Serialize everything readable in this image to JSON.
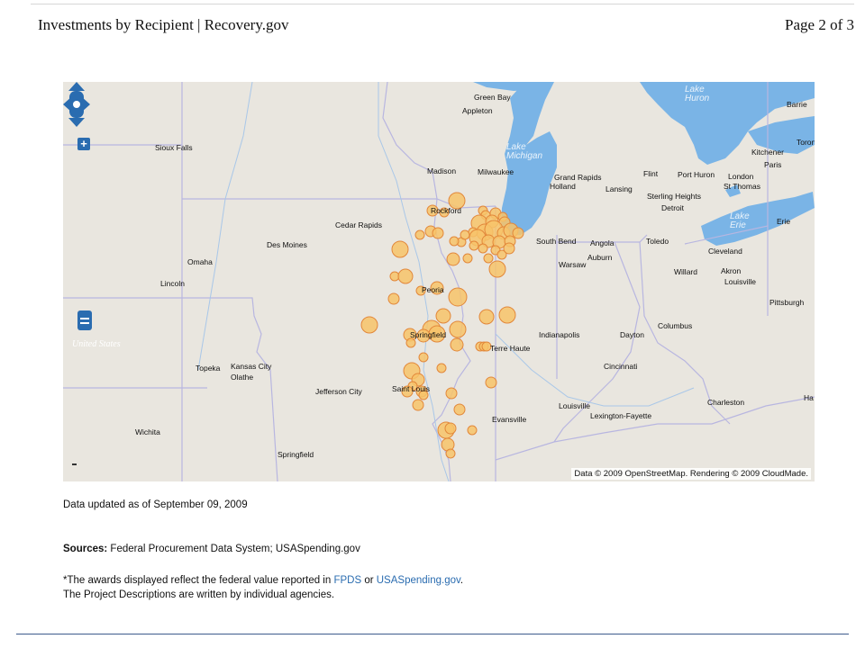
{
  "header": {
    "title": "Investments by Recipient | Recovery.gov",
    "page": "Page 2 of 3"
  },
  "map": {
    "attribution": "Data © 2009 OpenStreetMap. Rendering © 2009 CloudMade.",
    "colors": {
      "water": "#7ab4e6",
      "land": "#e9e6df",
      "marker_fill": "#f7c36a",
      "marker_stroke": "#e2873a",
      "state_line": "#b8b6e0"
    },
    "water_labels": [
      "Lake Michigan",
      "Lake Huron",
      "Lake Erie"
    ],
    "country_label": "United States",
    "cities": [
      {
        "name": "Green Bay"
      },
      {
        "name": "Appleton"
      },
      {
        "name": "Barrie"
      },
      {
        "name": "Toron"
      },
      {
        "name": "Sioux Falls"
      },
      {
        "name": "Madison"
      },
      {
        "name": "Milwaukee"
      },
      {
        "name": "Grand Rapids"
      },
      {
        "name": "Holland"
      },
      {
        "name": "Lansing"
      },
      {
        "name": "Flint"
      },
      {
        "name": "Port Huron"
      },
      {
        "name": "London"
      },
      {
        "name": "St Thomas"
      },
      {
        "name": "Kitchener"
      },
      {
        "name": "Paris"
      },
      {
        "name": "Sterling Heights"
      },
      {
        "name": "Detroit"
      },
      {
        "name": "Erie"
      },
      {
        "name": "Cedar Rapids"
      },
      {
        "name": "Rockford"
      },
      {
        "name": "Des Moines"
      },
      {
        "name": "South Bend"
      },
      {
        "name": "Angola"
      },
      {
        "name": "Toledo"
      },
      {
        "name": "Cleveland"
      },
      {
        "name": "Auburn"
      },
      {
        "name": "Warsaw"
      },
      {
        "name": "Omaha"
      },
      {
        "name": "Lincoln"
      },
      {
        "name": "Peoria"
      },
      {
        "name": "Willard"
      },
      {
        "name": "Akron"
      },
      {
        "name": "Louisville"
      },
      {
        "name": "Pittsburgh"
      },
      {
        "name": "Columbus"
      },
      {
        "name": "Springfield"
      },
      {
        "name": "Indianapolis"
      },
      {
        "name": "Dayton"
      },
      {
        "name": "Terre Haute"
      },
      {
        "name": "Topeka"
      },
      {
        "name": "Kansas City"
      },
      {
        "name": "Olathe"
      },
      {
        "name": "Cincinnati"
      },
      {
        "name": "Jefferson City"
      },
      {
        "name": "Saint Louis"
      },
      {
        "name": "Charleston"
      },
      {
        "name": "Ha"
      },
      {
        "name": "Louisville"
      },
      {
        "name": "Lexington-Fayette"
      },
      {
        "name": "Evansville"
      },
      {
        "name": "Wichita"
      },
      {
        "name": "Springfield"
      }
    ]
  },
  "notes": {
    "updated": "Data updated as of September 09, 2009",
    "sources_label": "Sources:",
    "sources_text": " Federal Procurement Data System; USASpending.gov",
    "awards_pre": "*The awards displayed reflect the federal value reported in ",
    "link_fpds": "FPDS",
    "awards_mid": " or ",
    "link_usas": "USASpending.gov",
    "awards_post": ".",
    "descriptions": "The Project Descriptions are written by individual agencies."
  }
}
